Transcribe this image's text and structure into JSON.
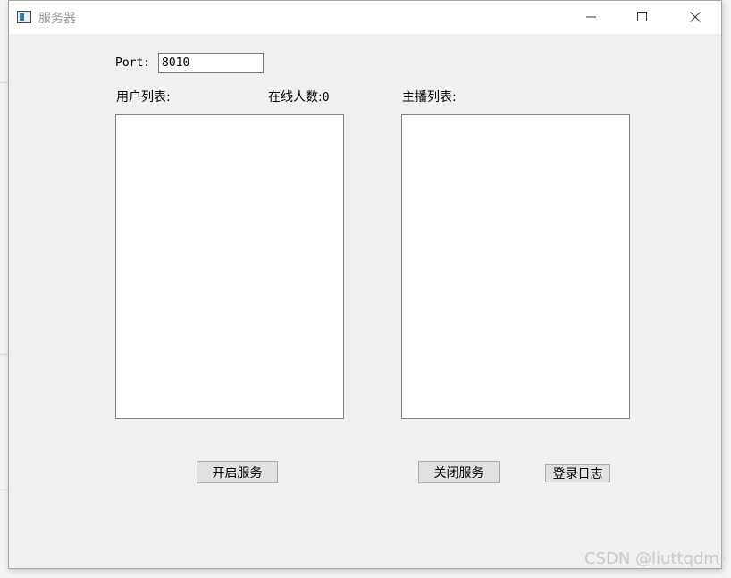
{
  "window": {
    "title": "服务器"
  },
  "form": {
    "port_label": "Port:",
    "port_value": "8010",
    "user_list_label": "用户列表:",
    "online_count_label": "在线人数:",
    "online_count_value": "0",
    "anchor_list_label": "主播列表:"
  },
  "buttons": {
    "start_service": "开启服务",
    "stop_service": "关闭服务",
    "login_log": "登录日志"
  },
  "watermark": "CSDN @liuttqdm",
  "colors": {
    "window_bg": "#f0f0f0",
    "titlebar_bg": "#ffffff",
    "button_bg": "#e1e1e1",
    "list_border": "#828282"
  }
}
